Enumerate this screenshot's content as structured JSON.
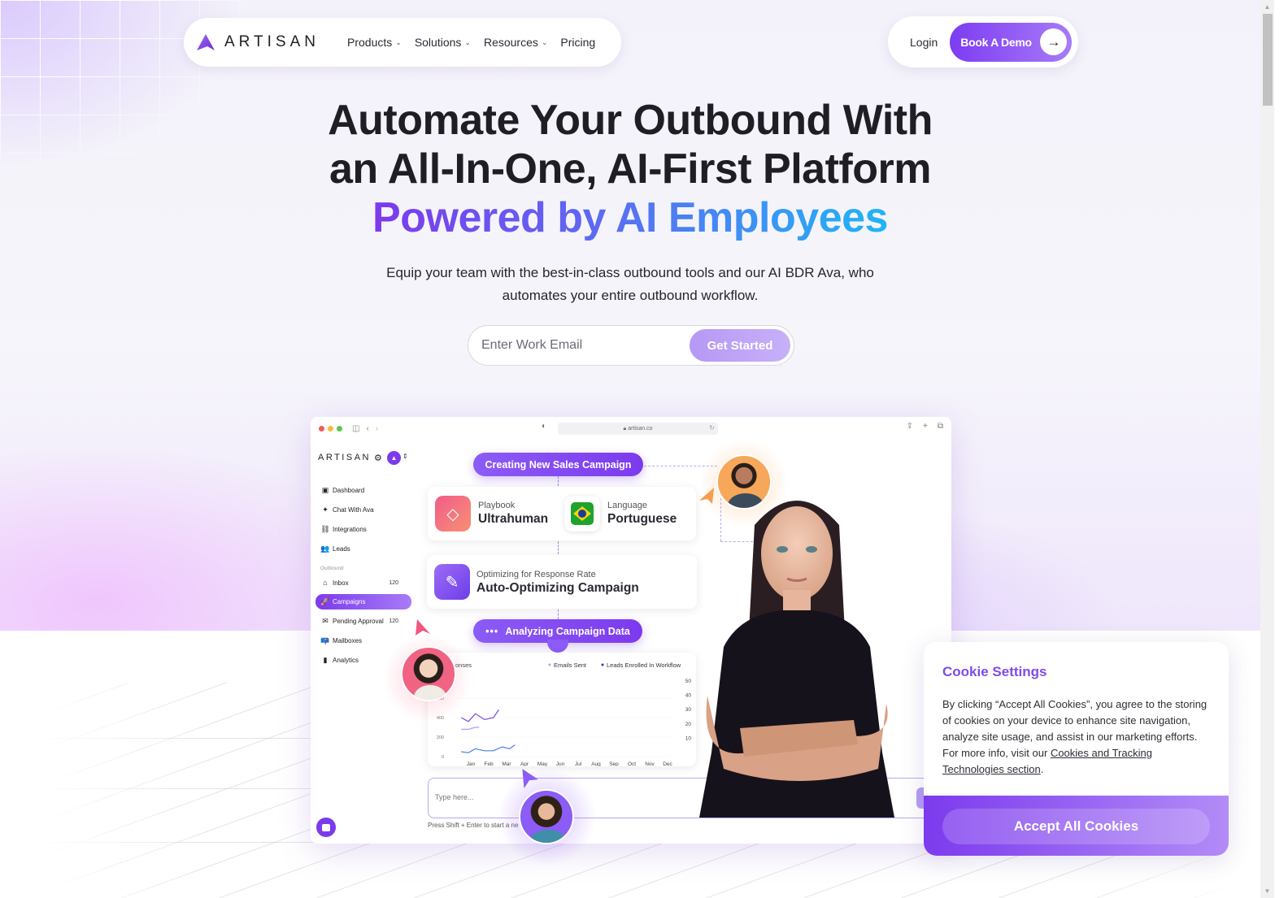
{
  "brand": {
    "name": "ARTISAN",
    "accent": "#7c3aed",
    "accent_light": "#a77bf8"
  },
  "nav": {
    "links": [
      {
        "label": "Products",
        "has_dropdown": true
      },
      {
        "label": "Solutions",
        "has_dropdown": true
      },
      {
        "label": "Resources",
        "has_dropdown": true
      },
      {
        "label": "Pricing",
        "has_dropdown": false
      }
    ],
    "login_label": "Login",
    "demo_label": "Book A Demo",
    "demo_icon": "arrow-right-icon"
  },
  "hero": {
    "title_line1": "Automate Your Outbound With",
    "title_line2": "an All-In-One, AI-First Platform",
    "title_accent": "Powered by AI Employees",
    "subtitle_line1": "Equip your team with the best-in-class outbound tools and our AI BDR Ava, who",
    "subtitle_line2": "automates your entire outbound workflow.",
    "email_placeholder": "Enter Work Email",
    "email_value": "",
    "cta_label": "Get Started"
  },
  "mockup": {
    "url": "artisan.co",
    "app_logo": "ARTISAN",
    "sidebar": {
      "items": [
        {
          "label": "Dashboard",
          "icon": "dashboard-icon",
          "glyph": "▣"
        },
        {
          "label": "Chat With Ava",
          "icon": "sparkle-icon",
          "glyph": "✦"
        },
        {
          "label": "Integrations",
          "icon": "link-icon",
          "glyph": "⛓"
        },
        {
          "label": "Leads",
          "icon": "users-icon",
          "glyph": "👥"
        }
      ],
      "section_label": "Outbound",
      "outbound_items": [
        {
          "label": "Inbox",
          "icon": "inbox-icon",
          "glyph": "⌂",
          "count": "120"
        },
        {
          "label": "Campaigns",
          "icon": "rocket-icon",
          "glyph": "🚀",
          "count": "",
          "active": true
        },
        {
          "label": "Pending Approval",
          "icon": "mail-icon",
          "glyph": "✉",
          "count": "120"
        },
        {
          "label": "Mailboxes",
          "icon": "mailbox-icon",
          "glyph": "📪",
          "count": ""
        },
        {
          "label": "Analytics",
          "icon": "bar-chart-icon",
          "glyph": "▮",
          "count": ""
        }
      ]
    },
    "pill_creating": "Creating New Sales Campaign",
    "pill_analyzing": "Analyzing Campaign Data",
    "playbook": {
      "label": "Playbook",
      "value": "Ultrahuman"
    },
    "language": {
      "label": "Language",
      "value": "Portuguese"
    },
    "optimizing": {
      "label": "Optimizing for Response Rate",
      "value": "Auto-Optimizing Campaign"
    },
    "chat_placeholder": "Type here...",
    "chat_hint": "Press Shift + Enter to start a ne"
  },
  "chart_data": {
    "type": "line",
    "title": "Responses",
    "title_visible": "onses",
    "legend": [
      "Emails Sent",
      "Leads Enrolled In Workflow"
    ],
    "legend_position": "top-right",
    "categories": [
      "Jan",
      "Feb",
      "Mar",
      "Apr",
      "May",
      "Jun",
      "Jul",
      "Aug",
      "Sep",
      "Oct",
      "Nov",
      "Dec"
    ],
    "y_left_ticks": [
      "0",
      "200",
      "400",
      "600"
    ],
    "y_right_ticks": [
      "10",
      "20",
      "30",
      "40",
      "50"
    ],
    "ylim_left": [
      0,
      800
    ],
    "series": [
      {
        "name": "Leads Enrolled In Workflow",
        "color": "#7c4fd8",
        "x": [
          0,
          0.4,
          0.8,
          1.3,
          1.8,
          2.1
        ],
        "values": [
          400,
          360,
          440,
          380,
          400,
          480
        ]
      },
      {
        "name": "Emails Sent",
        "color": "#b39ff0",
        "x": [
          0,
          0.4,
          0.8,
          1.0
        ],
        "values": [
          280,
          280,
          300,
          300
        ]
      },
      {
        "name": "Responses",
        "color": "#4a7fe0",
        "x": [
          0,
          0.4,
          0.8,
          1.3,
          1.8,
          2.3,
          2.7,
          3.0
        ],
        "values": [
          50,
          40,
          80,
          60,
          60,
          100,
          80,
          120
        ]
      }
    ]
  },
  "cookie": {
    "title": "Cookie Settings",
    "body": "By clicking “Accept All Cookies”, you agree to the storing of cookies on your device to enhance site navigation, analyze site usage, and assist in our marketing efforts. For more info, visit our ",
    "link": "Cookies and Tracking Technologies section",
    "body_end": ".",
    "accept_label": "Accept All Cookies"
  }
}
